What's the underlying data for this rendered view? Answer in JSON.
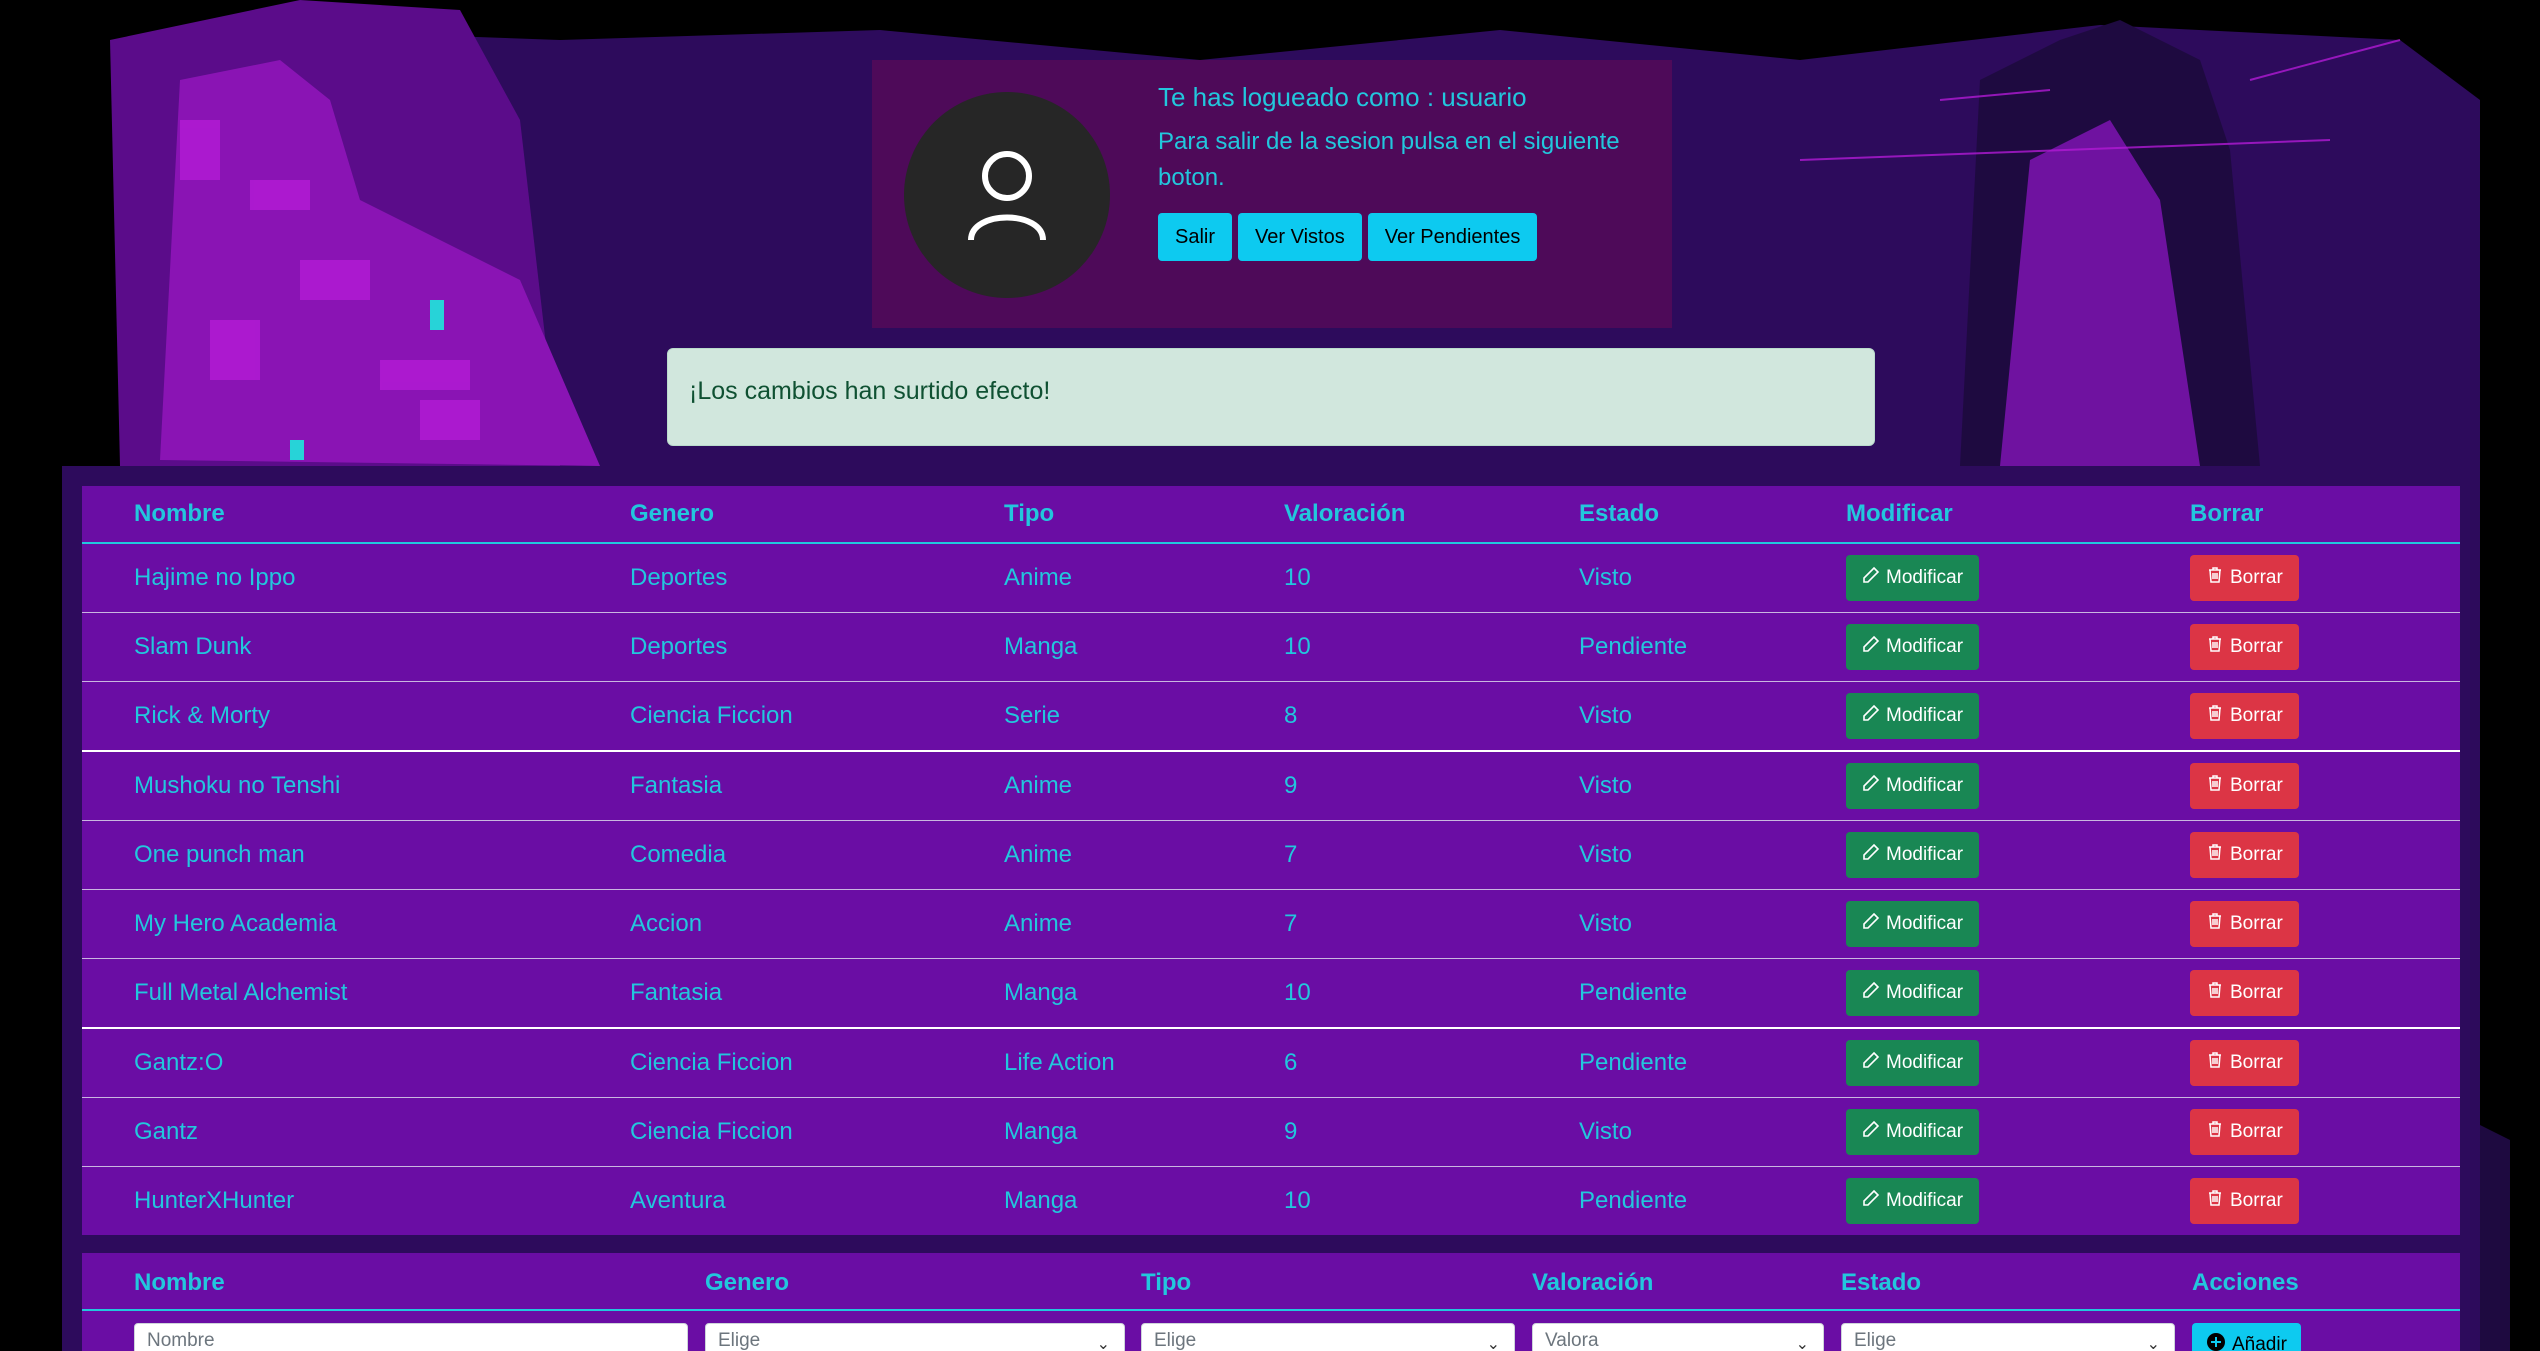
{
  "header": {
    "title": "Te has logueado como : usuario",
    "text": "Para salir de la sesion pulsa en el siguiente boton.",
    "buttons": [
      "Salir",
      "Ver Vistos",
      "Ver Pendientes"
    ]
  },
  "alert": {
    "message": "¡Los cambios han surtido efecto!"
  },
  "table": {
    "headers": [
      "Nombre",
      "Genero",
      "Tipo",
      "Valoración",
      "Estado",
      "Modificar",
      "Borrar"
    ],
    "modify_label": "Modificar",
    "delete_label": "Borrar",
    "rows": [
      {
        "nombre": "Hajime no Ippo",
        "genero": "Deportes",
        "tipo": "Anime",
        "valoracion": "10",
        "estado": "Visto"
      },
      {
        "nombre": "Slam Dunk",
        "genero": "Deportes",
        "tipo": "Manga",
        "valoracion": "10",
        "estado": "Pendiente"
      },
      {
        "nombre": "Rick & Morty",
        "genero": "Ciencia Ficcion",
        "tipo": "Serie",
        "valoracion": "8",
        "estado": "Visto"
      },
      {
        "nombre": "Mushoku no Tenshi",
        "genero": "Fantasia",
        "tipo": "Anime",
        "valoracion": "9",
        "estado": "Visto"
      },
      {
        "nombre": "One punch man",
        "genero": "Comedia",
        "tipo": "Anime",
        "valoracion": "7",
        "estado": "Visto"
      },
      {
        "nombre": "My Hero Academia",
        "genero": "Accion",
        "tipo": "Anime",
        "valoracion": "7",
        "estado": "Visto"
      },
      {
        "nombre": "Full Metal Alchemist",
        "genero": "Fantasia",
        "tipo": "Manga",
        "valoracion": "10",
        "estado": "Pendiente"
      },
      {
        "nombre": "Gantz:O",
        "genero": "Ciencia Ficcion",
        "tipo": "Life Action",
        "valoracion": "6",
        "estado": "Pendiente"
      },
      {
        "nombre": "Gantz",
        "genero": "Ciencia Ficcion",
        "tipo": "Manga",
        "valoracion": "9",
        "estado": "Visto"
      },
      {
        "nombre": "HunterXHunter",
        "genero": "Aventura",
        "tipo": "Manga",
        "valoracion": "10",
        "estado": "Pendiente"
      }
    ]
  },
  "form": {
    "headers": [
      "Nombre",
      "Genero",
      "Tipo",
      "Valoración",
      "Estado",
      "Acciones"
    ],
    "nombre_placeholder": "Nombre",
    "genero_value": "Elige",
    "tipo_value": "Elige",
    "valoracion_value": "Valora",
    "estado_value": "Elige",
    "add_label": "Añadir"
  },
  "colors": {
    "accent_text": "#22c7dd",
    "table_bg": "#6a0da4",
    "modify": "#198754",
    "delete": "#dc3545",
    "primary_btn": "#0dcaf0"
  }
}
